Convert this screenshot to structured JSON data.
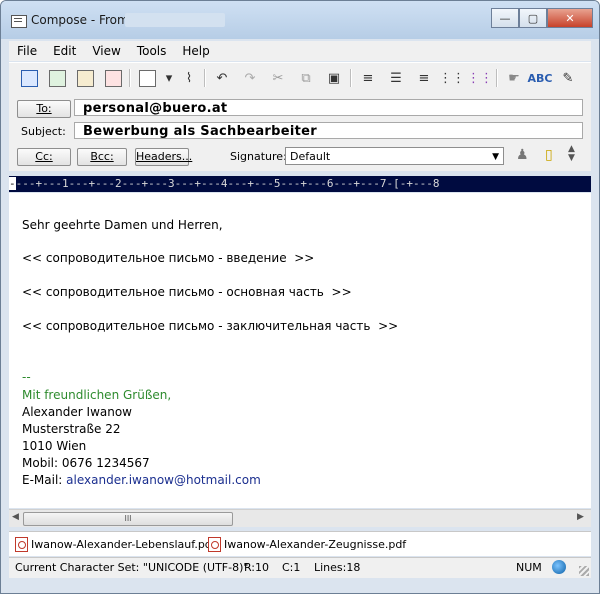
{
  "window": {
    "title": "Compose - From:",
    "buttons": {
      "minimize": "—",
      "maximize": "▢",
      "close": "✕"
    }
  },
  "menu": [
    "File",
    "Edit",
    "View",
    "Tools",
    "Help"
  ],
  "toolbar": {
    "icons": [
      "send-icon",
      "spellcheck-icon",
      "address-book-icon",
      "format-icon",
      "save-icon",
      "attach-icon",
      "undo-icon",
      "redo-icon",
      "cut-icon",
      "copy-icon",
      "paste-icon",
      "align-center-icon",
      "align-left-icon",
      "align-right-icon",
      "list-icon",
      "color-icon",
      "signature-icon",
      "spell-icon",
      "options-icon"
    ]
  },
  "header": {
    "to_label": "To:",
    "to_value": "personal@buero.at",
    "subject_label": "Subject:",
    "subject_value": "Bewerbung als Sachbearbeiter",
    "cc_label": "Cc:",
    "bcc_label": "Bcc:",
    "headers_label": "Headers...",
    "signature_label": "Signature:",
    "signature_value": "Default"
  },
  "ruler": {
    "cursor": "-",
    "text": "---+---1---+---2---+---3---+---4---+---5---+---6---+---7-[-+---8"
  },
  "body": {
    "greeting": "Sehr geehrte Damen und Herren,",
    "line1": "<< сопроводительное письмо - введение  >>",
    "line2": "<< сопроводительное письмо - основная часть  >>",
    "line3": "<< сопроводительное письмо - заключительная часть  >>",
    "sig_sep": "--",
    "closing": "Mit freundlichen Grüßen,",
    "name": "Alexander Iwanow",
    "street": "Musterstraße 22",
    "city": "1010 Wien",
    "mobile": "Mobil: 0676 1234567",
    "email_label": "E-Mail: ",
    "email": "alexander.iwanow@hotmail.com"
  },
  "attachments": [
    "Iwanow-Alexander-Lebenslauf.pdf",
    "Iwanow-Alexander-Zeugnisse.pdf"
  ],
  "status": {
    "charset": "Current Character Set: \"UNICODE (UTF-8)\"",
    "row": "R:10",
    "col": "C:1",
    "lines": "Lines:18",
    "num": "NUM"
  },
  "scrollbar": {
    "thumb": "III"
  }
}
